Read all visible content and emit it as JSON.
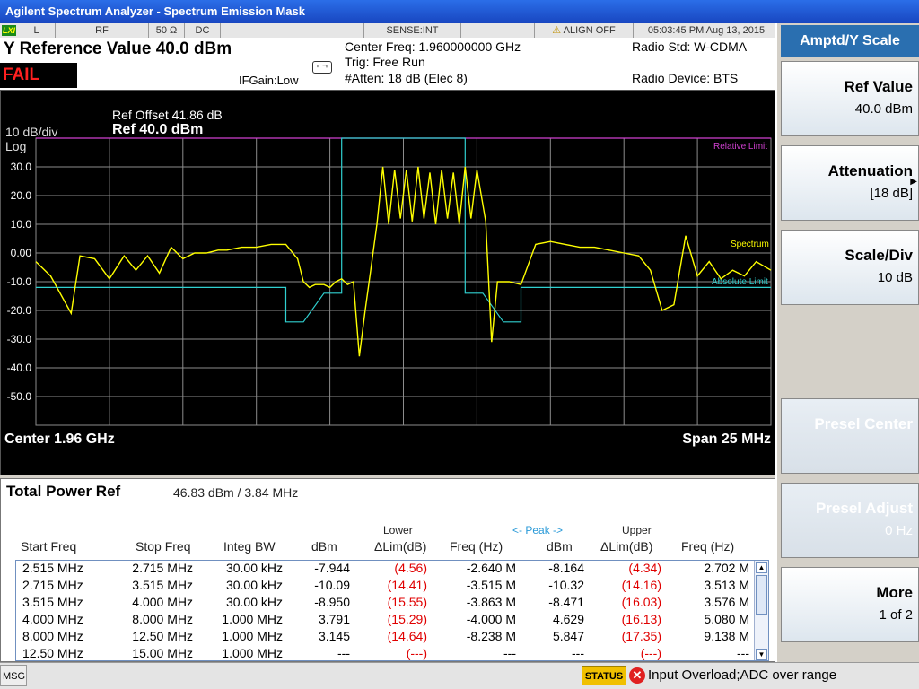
{
  "window": {
    "title": "Agilent Spectrum Analyzer - Spectrum Emission Mask"
  },
  "status_bar": {
    "lxi": "LXI",
    "input": "L",
    "rf": "RF",
    "impedance": "50 Ω",
    "coupling": "DC",
    "sense": "SENSE:INT",
    "align": "ALIGN OFF",
    "datetime": "05:03:45 PM Aug 13, 2015"
  },
  "header": {
    "y_reference": "Y Reference Value 40.0 dBm",
    "result": "FAIL",
    "ifgain": "IFGain:Low",
    "center_freq": "Center Freq: 1.960000000 GHz",
    "trig": "Trig: Free Run",
    "atten": "#Atten: 18 dB (Elec 8)",
    "radio_std": "Radio Std: W-CDMA",
    "radio_device": "Radio Device: BTS"
  },
  "plot": {
    "ref_offset": "Ref Offset 41.86 dB",
    "ref_level": "Ref 40.0 dBm",
    "scale": "10 dB/div",
    "scale_type": "Log",
    "center": "Center  1.96 GHz",
    "span": "Span 25 MHz",
    "legend": {
      "relative_limit": "Relative Limit",
      "spectrum": "Spectrum",
      "absolute_limit": "Absolute Limit"
    },
    "colors": {
      "spectrum": "#ffff00",
      "absolute_limit": "#30d0d0",
      "relative_limit": "#d040d0",
      "grid": "#8c8c8c"
    }
  },
  "chart_data": {
    "type": "line",
    "title": "",
    "xlabel": "",
    "ylabel": "",
    "y_ticks": [
      "30.0",
      "20.0",
      "10.0",
      "0.00",
      "-10.0",
      "-20.0",
      "-30.0",
      "-40.0",
      "-50.0"
    ],
    "xlim": [
      1947.5,
      1972.5
    ],
    "ylim": [
      -60,
      40
    ],
    "x_unit": "MHz",
    "y_unit": "dBm",
    "grid": true,
    "series": [
      {
        "name": "Spectrum",
        "x": [
          1947.5,
          1948.0,
          1948.7,
          1949.0,
          1949.5,
          1950.0,
          1950.5,
          1950.9,
          1951.3,
          1951.7,
          1952.1,
          1952.5,
          1952.9,
          1953.3,
          1953.7,
          1954.0,
          1954.5,
          1955.0,
          1955.5,
          1956.0,
          1956.4,
          1956.6,
          1956.8,
          1957.0,
          1957.3,
          1957.5,
          1957.7,
          1957.9,
          1958.1,
          1958.3,
          1958.5,
          1958.7,
          1958.9,
          1959.1,
          1959.3,
          1959.5,
          1959.7,
          1959.9,
          1960.1,
          1960.3,
          1960.5,
          1960.7,
          1960.9,
          1961.1,
          1961.3,
          1961.5,
          1961.7,
          1961.9,
          1962.1,
          1962.3,
          1962.5,
          1962.8,
          1963.0,
          1963.2,
          1963.4,
          1963.6,
          1964.0,
          1964.5,
          1965.0,
          1965.5,
          1966.0,
          1966.5,
          1967.0,
          1967.5,
          1968.0,
          1968.4,
          1968.8,
          1969.2,
          1969.6,
          1970.0,
          1970.4,
          1970.8,
          1971.2,
          1971.6,
          1972.0,
          1972.5
        ],
        "values": [
          -3,
          -8,
          -21,
          -1,
          -2,
          -9,
          -1,
          -6,
          -1,
          -7,
          2,
          -2,
          0,
          0,
          1,
          1,
          2,
          2,
          3,
          3,
          -2,
          -10,
          -12,
          -11,
          -11,
          -12,
          -10,
          -9,
          -11,
          -10,
          -36,
          -20,
          -5,
          10,
          30,
          10,
          29,
          12,
          29,
          11,
          30,
          12,
          28,
          10,
          29,
          12,
          28,
          10,
          30,
          12,
          29,
          11,
          -31,
          -10,
          -10,
          -10,
          -11,
          3,
          4,
          3,
          2,
          2,
          1,
          0,
          -1,
          -6,
          -20,
          -18,
          6,
          -8,
          -3,
          -9,
          -6,
          -8,
          -3,
          -6
        ]
      },
      {
        "name": "Absolute Limit",
        "x": [
          1947.5,
          1956.0,
          1956.0,
          1956.6,
          1957.3,
          1957.9,
          1957.9,
          1962.1,
          1962.1,
          1962.7,
          1963.4,
          1964.0,
          1964.0,
          1972.5
        ],
        "values": [
          -12,
          -12,
          -24,
          -24,
          -14,
          -14,
          40,
          40,
          -14,
          -14,
          -24,
          -24,
          -12,
          -12
        ]
      },
      {
        "name": "Relative Limit",
        "x": [
          1947.5,
          1972.5
        ],
        "values": [
          40,
          40
        ]
      }
    ]
  },
  "results": {
    "title": "Total Power Ref",
    "total_power": "46.83 dBm /   3.84 MHz",
    "group_lower": "Lower",
    "group_peak": "<- Peak ->",
    "group_upper": "Upper",
    "columns": [
      "Start Freq",
      "Stop Freq",
      "Integ BW",
      "dBm",
      "ΔLim(dB)",
      "Freq (Hz)",
      "dBm",
      "ΔLim(dB)",
      "Freq (Hz)"
    ],
    "rows": [
      [
        "2.515 MHz",
        "2.715 MHz",
        "30.00 kHz",
        "-7.944",
        "(4.56)",
        "-2.640 M",
        "-8.164",
        "(4.34)",
        "2.702 M"
      ],
      [
        "2.715 MHz",
        "3.515 MHz",
        "30.00 kHz",
        "-10.09",
        "(14.41)",
        "-3.515 M",
        "-10.32",
        "(14.16)",
        "3.513 M"
      ],
      [
        "3.515 MHz",
        "4.000 MHz",
        "30.00 kHz",
        "-8.950",
        "(15.55)",
        "-3.863 M",
        "-8.471",
        "(16.03)",
        "3.576 M"
      ],
      [
        "4.000 MHz",
        "8.000 MHz",
        "1.000 MHz",
        "3.791",
        "(15.29)",
        "-4.000 M",
        "4.629",
        "(16.13)",
        "5.080 M"
      ],
      [
        "8.000 MHz",
        "12.50 MHz",
        "1.000 MHz",
        "3.145",
        "(14.64)",
        "-8.238 M",
        "5.847",
        "(17.35)",
        "9.138 M"
      ],
      [
        "12.50 MHz",
        "15.00 MHz",
        "1.000 MHz",
        "---",
        "(---)",
        "---",
        "---",
        "(---)",
        "---"
      ]
    ]
  },
  "bottom_bar": {
    "msg": "MSG",
    "status": "STATUS",
    "error_icon": "x-circle-icon",
    "error": "Input Overload;ADC over range"
  },
  "softkeys": {
    "title": "Amptd/Y Scale",
    "keys": [
      {
        "label": "Ref Value",
        "value": "40.0 dBm",
        "enabled": true
      },
      {
        "label": "Attenuation",
        "value": "[18 dB]",
        "enabled": true
      },
      {
        "label": "Scale/Div",
        "value": "10 dB",
        "enabled": true
      },
      {
        "label": "Presel Center",
        "value": "",
        "enabled": false
      },
      {
        "label": "Presel Adjust",
        "value": "0 Hz",
        "enabled": false
      },
      {
        "label": "More",
        "value": "1 of 2",
        "enabled": true
      }
    ]
  }
}
